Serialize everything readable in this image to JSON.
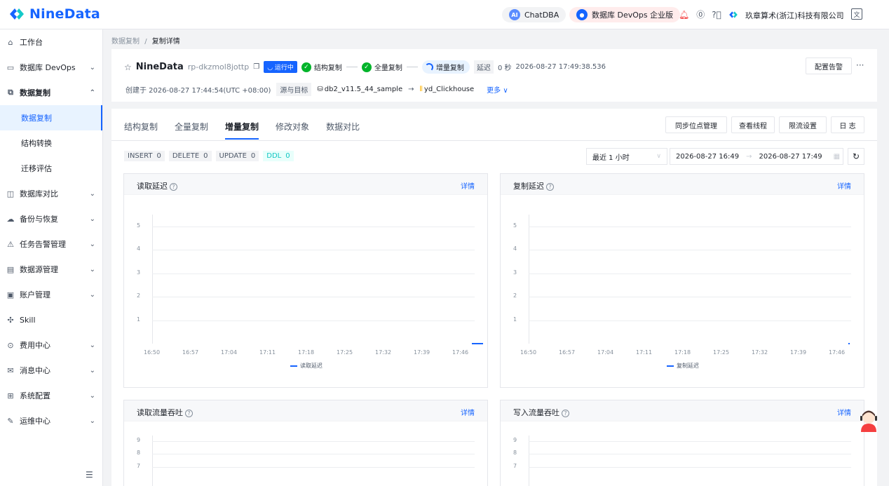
{
  "brand": {
    "name": "NineData",
    "color": "#1664ff"
  },
  "topbar": {
    "chatdba": "ChatDBA",
    "devops": "数据库 DevOps 企业版",
    "company": "玖章算术(浙江)科技有限公司",
    "icons": [
      "notification-icon",
      "yuan-icon",
      "help-icon",
      "lang-icon"
    ]
  },
  "sidebar": {
    "items": [
      {
        "label": "工作台",
        "icon": "home-icon"
      },
      {
        "label": "数据库 DevOps",
        "icon": "devops-icon",
        "chev": "⌄"
      },
      {
        "label": "数据复制",
        "icon": "replication-icon",
        "chev": "⌃"
      },
      {
        "label": "数据复制"
      },
      {
        "label": "结构转换"
      },
      {
        "label": "迁移评估"
      },
      {
        "label": "数据库对比",
        "icon": "compare-icon",
        "chev": "⌄"
      },
      {
        "label": "备份与恢复",
        "icon": "backup-icon",
        "chev": "⌄"
      },
      {
        "label": "任务告警管理",
        "icon": "alarm-icon",
        "chev": "⌄"
      },
      {
        "label": "数据源管理",
        "icon": "datasource-icon",
        "chev": "⌄"
      },
      {
        "label": "账户管理",
        "icon": "account-icon",
        "chev": "⌄"
      },
      {
        "label": "Skill",
        "icon": "skill-icon"
      },
      {
        "label": "费用中心",
        "icon": "billing-icon",
        "chev": "⌄"
      },
      {
        "label": "消息中心",
        "icon": "message-icon",
        "chev": "⌄"
      },
      {
        "label": "系统配置",
        "icon": "settings-icon",
        "chev": "⌄"
      },
      {
        "label": "运维中心",
        "icon": "ops-icon",
        "chev": "⌄"
      }
    ]
  },
  "breadcrumb": {
    "parent": "数据复制",
    "sep": "/",
    "current": "复制详情"
  },
  "task": {
    "name": "NineData",
    "id": "rp-dkzmol8jottp",
    "status": "运行中",
    "stages": [
      "结构复制",
      "全量复制",
      "增量复制"
    ],
    "delay_label": "延迟",
    "delay_value": "0 秒",
    "delay_time": "2026-08-27 17:49:38.536",
    "created": "创建于 2026-08-27 17:44:54(UTC +08:00)",
    "src_tgt_label": "源与目标",
    "source": "db2_v11.5_44_sample",
    "arrow": "→",
    "target": "yd_Clickhouse",
    "more": "更多 ∨",
    "alarm_btn": "配置告警",
    "more_dots": "···"
  },
  "tabs": [
    "结构复制",
    "全量复制",
    "增量复制",
    "修改对象",
    "数据对比"
  ],
  "actions": [
    "同步位点管理",
    "查看线程",
    "限流设置",
    "日 志"
  ],
  "counters": [
    {
      "label": "INSERT",
      "value": "0"
    },
    {
      "label": "DELETE",
      "value": "0"
    },
    {
      "label": "UPDATE",
      "value": "0"
    },
    {
      "label": "DDL",
      "value": "0"
    }
  ],
  "filter": {
    "range": "最近 1 小时",
    "start": "2026-08-27 16:49",
    "arrow": "→",
    "end": "2026-08-27 17:49"
  },
  "panels": [
    {
      "title": "读取延迟",
      "detail": "详情"
    },
    {
      "title": "复制延迟",
      "detail": "详情"
    },
    {
      "title": "读取流量吞吐",
      "detail": "详情"
    },
    {
      "title": "写入流量吞吐",
      "detail": "详情"
    }
  ],
  "chart_data": [
    {
      "type": "line",
      "title": "读取延迟",
      "x": [
        "16:50",
        "16:57",
        "17:04",
        "17:11",
        "17:18",
        "17:25",
        "17:32",
        "17:39",
        "17:46"
      ],
      "yticks": [
        1,
        2,
        3,
        4,
        5
      ],
      "ylim": [
        0,
        5.5
      ],
      "series": [
        {
          "name": "读取延迟",
          "color": "#1664ff",
          "values": [
            0,
            0,
            0,
            0,
            0,
            0,
            0,
            0,
            0
          ]
        }
      ]
    },
    {
      "type": "line",
      "title": "复制延迟",
      "x": [
        "16:50",
        "16:57",
        "17:04",
        "17:11",
        "17:18",
        "17:25",
        "17:32",
        "17:39",
        "17:46"
      ],
      "yticks": [
        1,
        2,
        3,
        4,
        5
      ],
      "ylim": [
        0,
        5.5
      ],
      "series": [
        {
          "name": "复制延迟",
          "color": "#1664ff",
          "values": [
            0,
            0,
            0,
            0,
            0,
            0,
            0,
            0,
            0
          ]
        }
      ]
    },
    {
      "type": "line",
      "title": "读取流量吞吐",
      "yticks": [
        7,
        8,
        9
      ]
    },
    {
      "type": "line",
      "title": "写入流量吞吐",
      "yticks": [
        7,
        8,
        9
      ]
    }
  ]
}
